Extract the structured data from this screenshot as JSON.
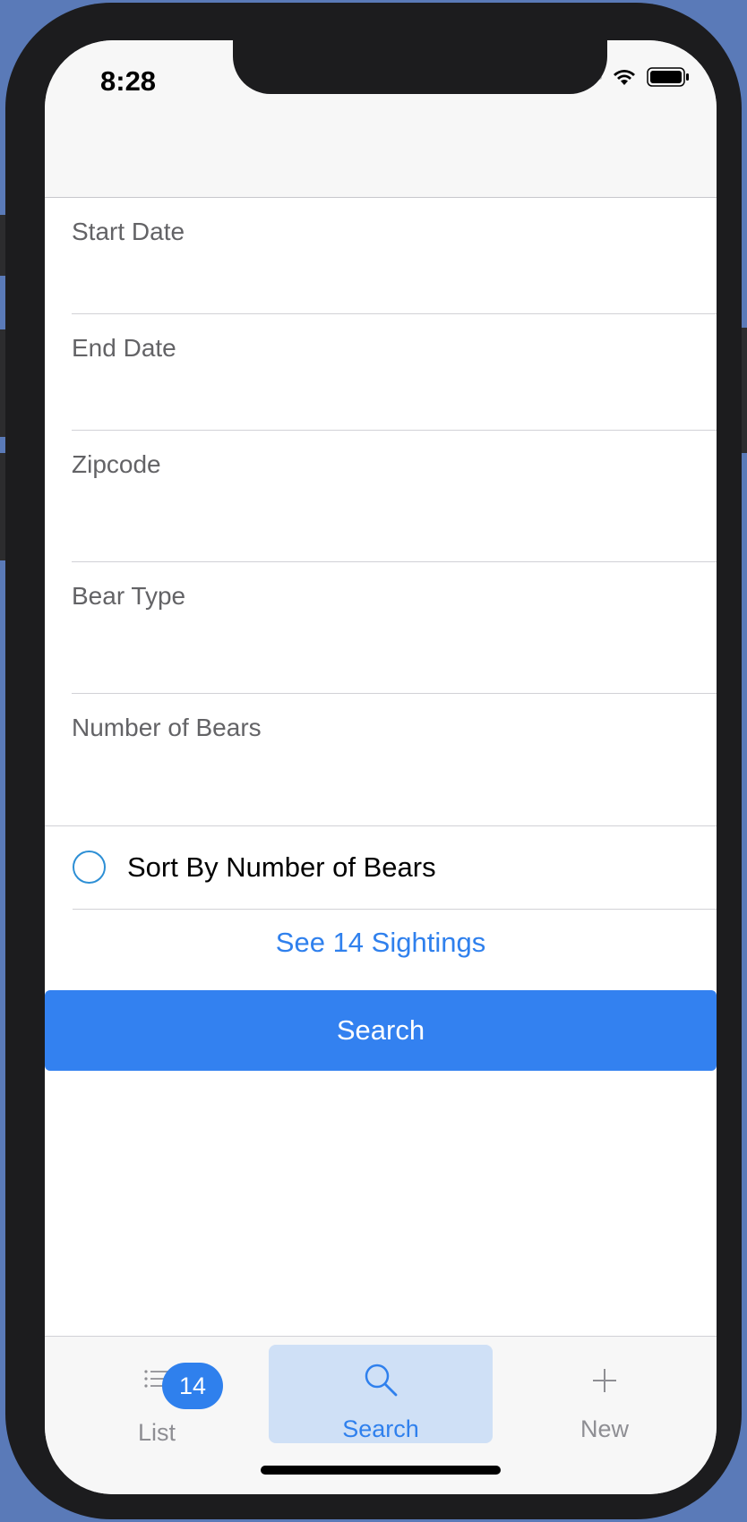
{
  "status_bar": {
    "time": "8:28"
  },
  "form": {
    "fields": [
      {
        "label": "Start Date"
      },
      {
        "label": "End Date"
      },
      {
        "label": "Zipcode"
      },
      {
        "label": "Bear Type"
      },
      {
        "label": "Number of Bears"
      }
    ],
    "sort_label": "Sort By Number of Bears",
    "sort_checked": false,
    "see_sightings_label": "See 14 Sightings",
    "search_button_label": "Search"
  },
  "tabbar": {
    "tabs": [
      {
        "label": "List",
        "icon": "list-icon",
        "badge": "14",
        "selected": false
      },
      {
        "label": "Search",
        "icon": "search-icon",
        "selected": true
      },
      {
        "label": "New",
        "icon": "plus-icon",
        "selected": false
      }
    ]
  },
  "colors": {
    "accent": "#3381f0",
    "link": "#2f80ed",
    "selected_tab_bg": "#cfe0f6",
    "background": "#5a7ab8"
  }
}
